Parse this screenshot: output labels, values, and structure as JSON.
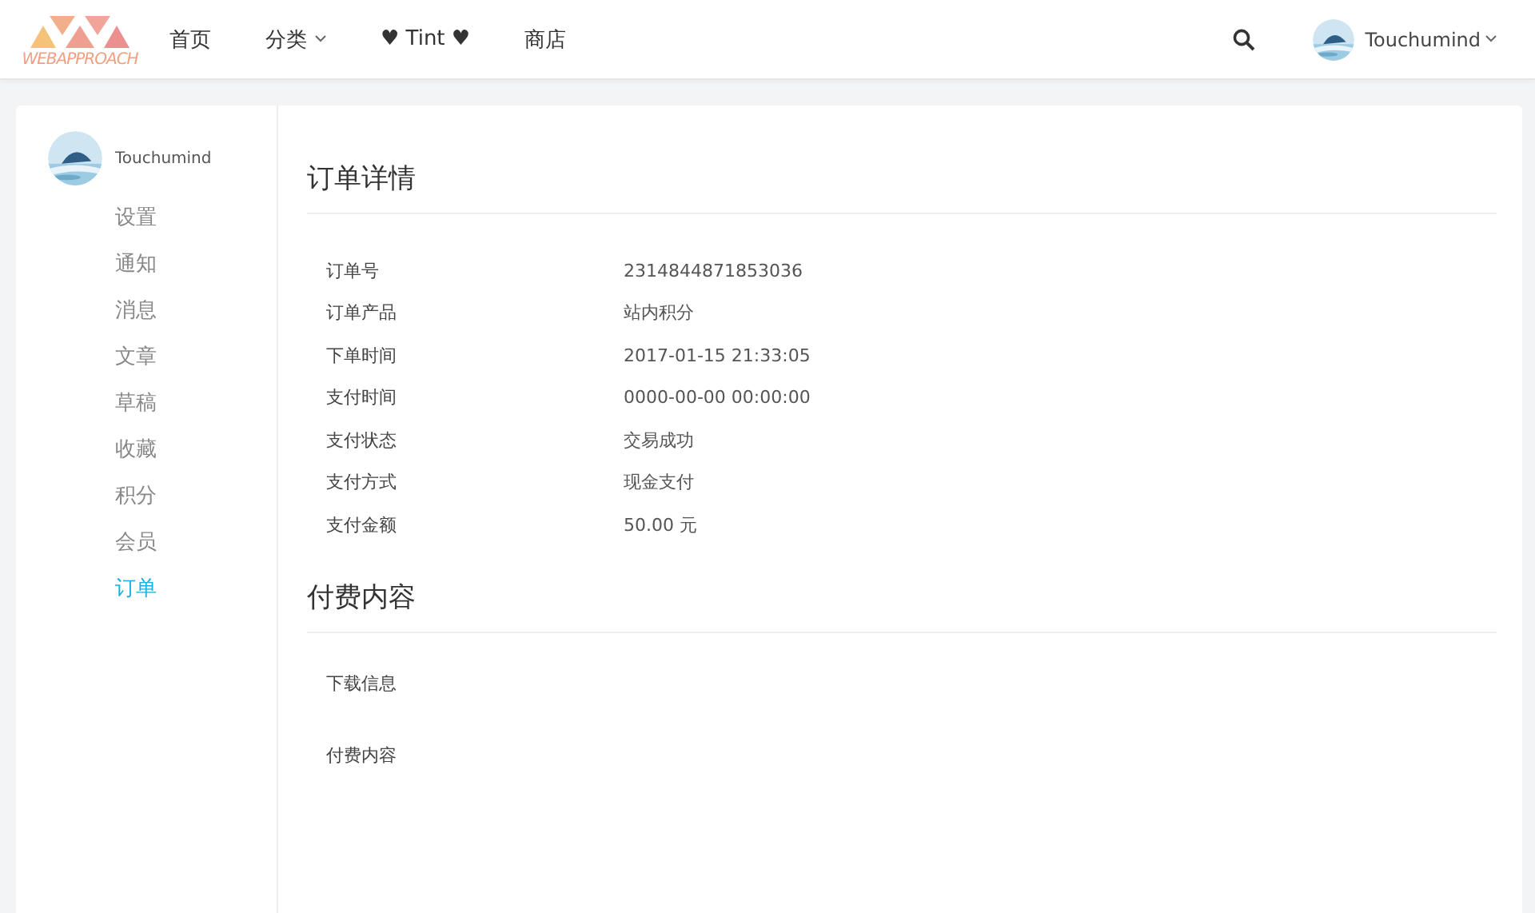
{
  "header": {
    "logo_text": "WEBAPPROACH",
    "nav": [
      {
        "label": "首页",
        "dropdown": false
      },
      {
        "label": "分类",
        "dropdown": true
      },
      {
        "label": "♥ Tint ♥",
        "dropdown": false
      },
      {
        "label": "商店",
        "dropdown": false
      }
    ],
    "user": {
      "name": "Touchumind"
    }
  },
  "sidebar": {
    "user": {
      "name": "Touchumind"
    },
    "items": [
      {
        "label": "设置",
        "selected": false
      },
      {
        "label": "通知",
        "selected": false
      },
      {
        "label": "消息",
        "selected": false
      },
      {
        "label": "文章",
        "selected": false
      },
      {
        "label": "草稿",
        "selected": false
      },
      {
        "label": "收藏",
        "selected": false
      },
      {
        "label": "积分",
        "selected": false
      },
      {
        "label": "会员",
        "selected": false
      },
      {
        "label": "订单",
        "selected": true
      }
    ]
  },
  "order_details": {
    "title": "订单详情",
    "rows": [
      {
        "label": "订单号",
        "value": "2314844871853036"
      },
      {
        "label": "订单产品",
        "value": "站内积分"
      },
      {
        "label": "下单时间",
        "value": "2017-01-15 21:33:05"
      },
      {
        "label": "支付时间",
        "value": "0000-00-00 00:00:00"
      },
      {
        "label": "支付状态",
        "value": "交易成功"
      },
      {
        "label": "支付方式",
        "value": "现金支付"
      },
      {
        "label": "支付金额",
        "value": "50.00 元"
      }
    ]
  },
  "paid_content": {
    "title": "付费内容",
    "rows": [
      {
        "label": "下载信息"
      },
      {
        "label": "付费内容"
      }
    ]
  }
}
